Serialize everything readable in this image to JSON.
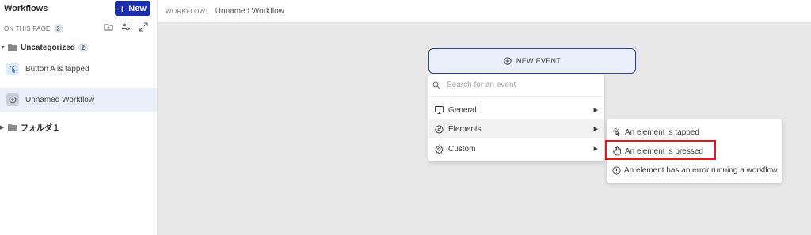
{
  "sidebar": {
    "title": "Workflows",
    "new_button": "New",
    "on_this_page_label": "ON THIS PAGE",
    "on_this_page_count": "2",
    "folders": [
      {
        "name": "Uncategorized",
        "count": "2"
      },
      {
        "name": "フォルダ１"
      }
    ],
    "items": [
      {
        "label": "Button A is tapped",
        "icon": "tap-icon"
      },
      {
        "label": "Unnamed Workflow",
        "icon": "plus-circle-icon",
        "selected": true
      }
    ]
  },
  "header": {
    "label": "WORKFLOW:",
    "workflow_name": "Unnamed Workflow"
  },
  "new_event": {
    "label": "NEW EVENT"
  },
  "dropdown": {
    "search_placeholder": "Search for an event",
    "items": [
      {
        "label": "General",
        "icon": "monitor-icon"
      },
      {
        "label": "Elements",
        "icon": "compass-icon",
        "active": true
      },
      {
        "label": "Custom",
        "icon": "gear-icon"
      }
    ]
  },
  "submenu": {
    "items": [
      {
        "label": "An element is tapped",
        "icon": "tap-icon"
      },
      {
        "label": "An element is pressed",
        "icon": "hand-icon",
        "highlighted": true
      },
      {
        "label": "An element has an error running a workflow",
        "icon": "error-icon"
      }
    ]
  },
  "colors": {
    "brand": "#1a2fae",
    "highlight": "#e01a1a",
    "selected_bg": "#e9f0fb"
  }
}
